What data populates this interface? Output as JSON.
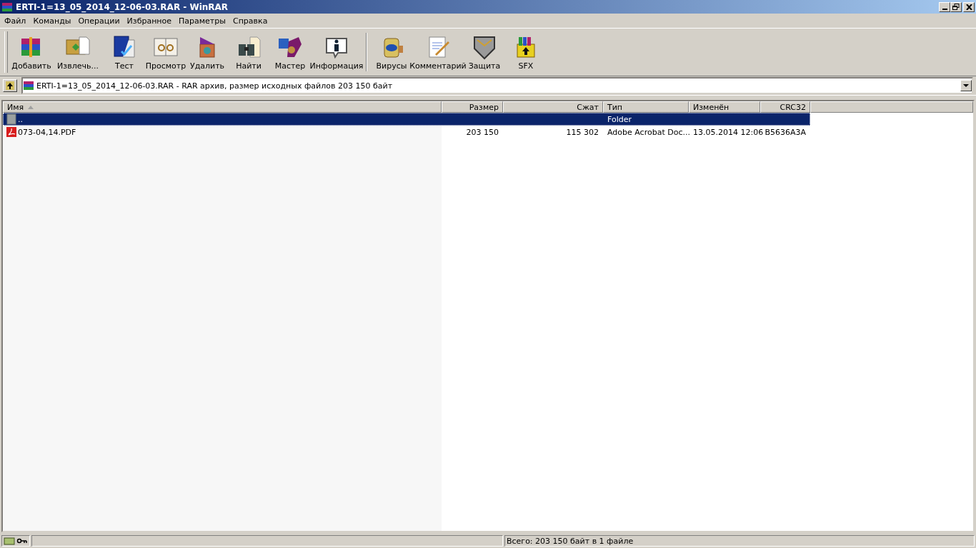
{
  "window": {
    "title": "ERTI-1=13_05_2014_12-06-03.RAR - WinRAR"
  },
  "menu": [
    "Файл",
    "Команды",
    "Операции",
    "Избранное",
    "Параметры",
    "Справка"
  ],
  "toolbar": [
    {
      "buttons": [
        {
          "label": "Добавить",
          "kind": "add"
        },
        {
          "label": "Извлечь...",
          "kind": "extract"
        },
        {
          "label": "Тест",
          "kind": "test"
        },
        {
          "label": "Просмотр",
          "kind": "view"
        },
        {
          "label": "Удалить",
          "kind": "delete"
        },
        {
          "label": "Найти",
          "kind": "find"
        },
        {
          "label": "Мастер",
          "kind": "wizard"
        },
        {
          "label": "Информация",
          "kind": "info"
        }
      ]
    },
    {
      "buttons": [
        {
          "label": "Вирусы",
          "kind": "virus"
        },
        {
          "label": "Комментарий",
          "kind": "comment"
        },
        {
          "label": "Защита",
          "kind": "protect"
        },
        {
          "label": "SFX",
          "kind": "sfx"
        }
      ]
    }
  ],
  "address": {
    "value": "ERTI-1=13_05_2014_12-06-03.RAR - RAR архив, размер исходных файлов 203 150 байт"
  },
  "table": {
    "columns": [
      {
        "label": "Имя",
        "sorted": true
      },
      {
        "label": "Размер",
        "sorted": false
      },
      {
        "label": "Сжат",
        "sorted": false
      },
      {
        "label": "Тип",
        "sorted": false
      },
      {
        "label": "Изменён",
        "sorted": false
      },
      {
        "label": "CRC32",
        "sorted": false
      }
    ],
    "rows": [
      {
        "kind": "parent",
        "name": "..",
        "type": "Folder",
        "selected": true
      },
      {
        "kind": "pdf",
        "name": "073-04,14.PDF",
        "size": "203 150",
        "packed": "115 302",
        "type": "Adobe Acrobat Doc...",
        "modified": "13.05.2014 12:06",
        "crc": "B5636A3A",
        "selected": false
      }
    ]
  },
  "status_bar": {
    "total": "Всего: 203 150 байт в 1 файле"
  }
}
